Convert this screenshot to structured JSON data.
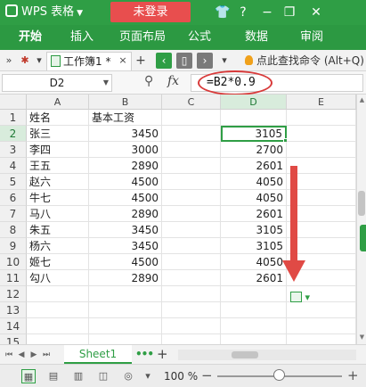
{
  "titlebar": {
    "app_name": "WPS 表格",
    "login_label": "未登录",
    "icons": [
      "shirt-icon",
      "help-icon",
      "minimize-icon",
      "restore-icon",
      "close-icon"
    ]
  },
  "menu": {
    "items": [
      "开始",
      "插入",
      "页面布局",
      "公式",
      "数据",
      "审阅"
    ],
    "active": "开始"
  },
  "tabbar": {
    "doc_tab_label": "工作簿1 *",
    "close_glyph": "×",
    "add_glyph": "+",
    "search_command": "点此查找命令 (Alt+Q)",
    "nav_prev_color": "#2f9e45",
    "nav_next_color": "#7a7a7a"
  },
  "formula": {
    "cell_ref": "D2",
    "fx_label": "fx",
    "content": "=B2*0.9",
    "highlight_color": "#d83a3a"
  },
  "sheet": {
    "columns": [
      "A",
      "B",
      "C",
      "D",
      "E"
    ],
    "selected_column": "D",
    "selected_row": 2,
    "rows": [
      {
        "n": "1",
        "a": "姓名",
        "b": "基本工资",
        "d": ""
      },
      {
        "n": "2",
        "a": "张三",
        "b": "3450",
        "d": "3105"
      },
      {
        "n": "3",
        "a": "李四",
        "b": "3000",
        "d": "2700"
      },
      {
        "n": "4",
        "a": "王五",
        "b": "2890",
        "d": "2601"
      },
      {
        "n": "5",
        "a": "赵六",
        "b": "4500",
        "d": "4050"
      },
      {
        "n": "6",
        "a": "牛七",
        "b": "4500",
        "d": "4050"
      },
      {
        "n": "7",
        "a": "马八",
        "b": "2890",
        "d": "2601"
      },
      {
        "n": "8",
        "a": "朱五",
        "b": "3450",
        "d": "3105"
      },
      {
        "n": "9",
        "a": "杨六",
        "b": "3450",
        "d": "3105"
      },
      {
        "n": "10",
        "a": "姬七",
        "b": "4500",
        "d": "4050"
      },
      {
        "n": "11",
        "a": "勾八",
        "b": "2890",
        "d": "2601"
      },
      {
        "n": "12",
        "a": "",
        "b": "",
        "d": ""
      },
      {
        "n": "13",
        "a": "",
        "b": "",
        "d": ""
      },
      {
        "n": "14",
        "a": "",
        "b": "",
        "d": ""
      },
      {
        "n": "15",
        "a": "",
        "b": "",
        "d": ""
      }
    ],
    "accent_color": "#2f9e45",
    "arrow_color": "#e04a45"
  },
  "sheet_tabs": {
    "active_tab": "Sheet1",
    "add_glyph": "+"
  },
  "status": {
    "zoom_label": "100 %",
    "zoom_minus": "−",
    "zoom_plus": "+"
  }
}
